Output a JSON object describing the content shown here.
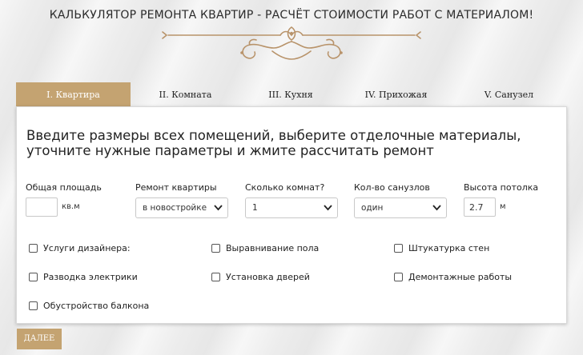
{
  "page_title": "Калькулятор ремонта квартир - расчёт стоимости работ с материалом!",
  "tabs": [
    {
      "label": "I. Квартира",
      "active": true
    },
    {
      "label": "II. Комната",
      "active": false
    },
    {
      "label": "III. Кухня",
      "active": false
    },
    {
      "label": "IV. Прихожая",
      "active": false
    },
    {
      "label": "V. Санузел",
      "active": false
    }
  ],
  "form": {
    "heading": "Введите размеры всех помещений, выберите отделочные материалы, уточните нужные параметры и жмите рассчитать ремонт",
    "area": {
      "label": "Общая площадь",
      "value": "",
      "unit": "кв.м"
    },
    "repair_type": {
      "label": "Ремонт квартиры",
      "value": "в новостройке"
    },
    "rooms": {
      "label": "Сколько комнат?",
      "value": "1"
    },
    "bathrooms": {
      "label": "Кол-во санузлов",
      "value": "один"
    },
    "ceiling": {
      "label": "Высота потолка",
      "value": "2.7",
      "unit": "м"
    },
    "checkboxes": [
      {
        "label": "Услуги дизайнера:",
        "checked": false
      },
      {
        "label": "Выравнивание пола",
        "checked": false
      },
      {
        "label": "Штукатурка стен",
        "checked": false
      },
      {
        "label": "Разводка электрики",
        "checked": false
      },
      {
        "label": "Установка дверей",
        "checked": false
      },
      {
        "label": "Демонтажные работы",
        "checked": false
      },
      {
        "label": "Обустройство балкона",
        "checked": false
      }
    ]
  },
  "next_button": "ДАЛЕЕ",
  "colors": {
    "accent": "#c4a371",
    "ornament": "#b8936a"
  }
}
